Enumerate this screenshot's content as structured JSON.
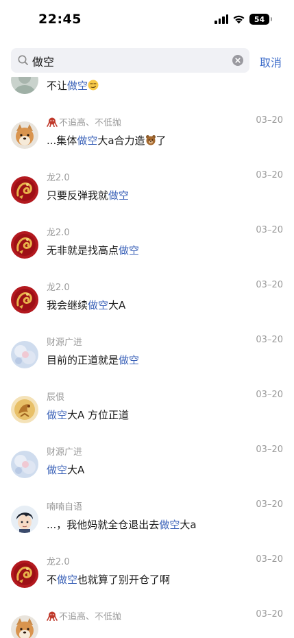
{
  "status_bar": {
    "time": "22:45",
    "battery": "54"
  },
  "search": {
    "query": "做空",
    "cancel_label": "取消"
  },
  "colors": {
    "highlight": "#3b62b8",
    "cancel": "#3b6bc9",
    "meta_gray": "#9a9a9a",
    "search_bg": "#f0f1f5"
  },
  "results": [
    {
      "username": "",
      "date": "",
      "avatar": "gray-avatar-icon",
      "message": [
        {
          "text": "不让"
        },
        {
          "text": "做空",
          "hl": true
        },
        {
          "emoji": "smirk-emoji-icon"
        }
      ]
    },
    {
      "user_icon": "octopus-icon",
      "username": "不追高、不低抛",
      "date": "03–20",
      "avatar": "dog-avatar-icon",
      "message": [
        {
          "text": "...集体"
        },
        {
          "text": "做空",
          "hl": true
        },
        {
          "text": "大a合力造"
        },
        {
          "emoji": "bear-emoji-icon"
        },
        {
          "text": "了"
        }
      ]
    },
    {
      "username": "龙2.0",
      "date": "03–20",
      "avatar": "dragon-avatar-icon",
      "message": [
        {
          "text": "只要反弹我就"
        },
        {
          "text": "做空",
          "hl": true
        }
      ]
    },
    {
      "username": "龙2.0",
      "date": "03–20",
      "avatar": "dragon-avatar-icon",
      "message": [
        {
          "text": "无非就是找高点"
        },
        {
          "text": "做空",
          "hl": true
        }
      ]
    },
    {
      "username": "龙2.0",
      "date": "03–20",
      "avatar": "dragon-avatar-icon",
      "message": [
        {
          "text": "我会继续"
        },
        {
          "text": "做空",
          "hl": true
        },
        {
          "text": "大A"
        }
      ]
    },
    {
      "username": "财源广进",
      "date": "03–20",
      "avatar": "blue-cloud-avatar-icon",
      "message": [
        {
          "text": "目前的正道就是"
        },
        {
          "text": "做空",
          "hl": true
        }
      ]
    },
    {
      "username": "辰佷",
      "date": "03–20",
      "avatar": "gold-avatar-icon",
      "message": [
        {
          "text": "做空",
          "hl": true
        },
        {
          "text": "大A 方位正道"
        }
      ]
    },
    {
      "username": "财源广进",
      "date": "03–20",
      "avatar": "blue-cloud-avatar-icon",
      "message": [
        {
          "text": "做空",
          "hl": true
        },
        {
          "text": "大A"
        }
      ]
    },
    {
      "username": "喃喃自语",
      "date": "03–20",
      "avatar": "anime-boy-avatar-icon",
      "message": [
        {
          "text": "...，我他妈就全仓退出去"
        },
        {
          "text": "做空",
          "hl": true
        },
        {
          "text": "大a"
        }
      ]
    },
    {
      "username": "龙2.0",
      "date": "03–20",
      "avatar": "dragon-avatar-icon",
      "message": [
        {
          "text": "不"
        },
        {
          "text": "做空",
          "hl": true
        },
        {
          "text": "也就算了别开仓了啊"
        }
      ]
    },
    {
      "user_icon": "octopus-icon",
      "username": "不追高、不低抛",
      "date": "03–20",
      "avatar": "dog-avatar-icon",
      "message": []
    }
  ]
}
